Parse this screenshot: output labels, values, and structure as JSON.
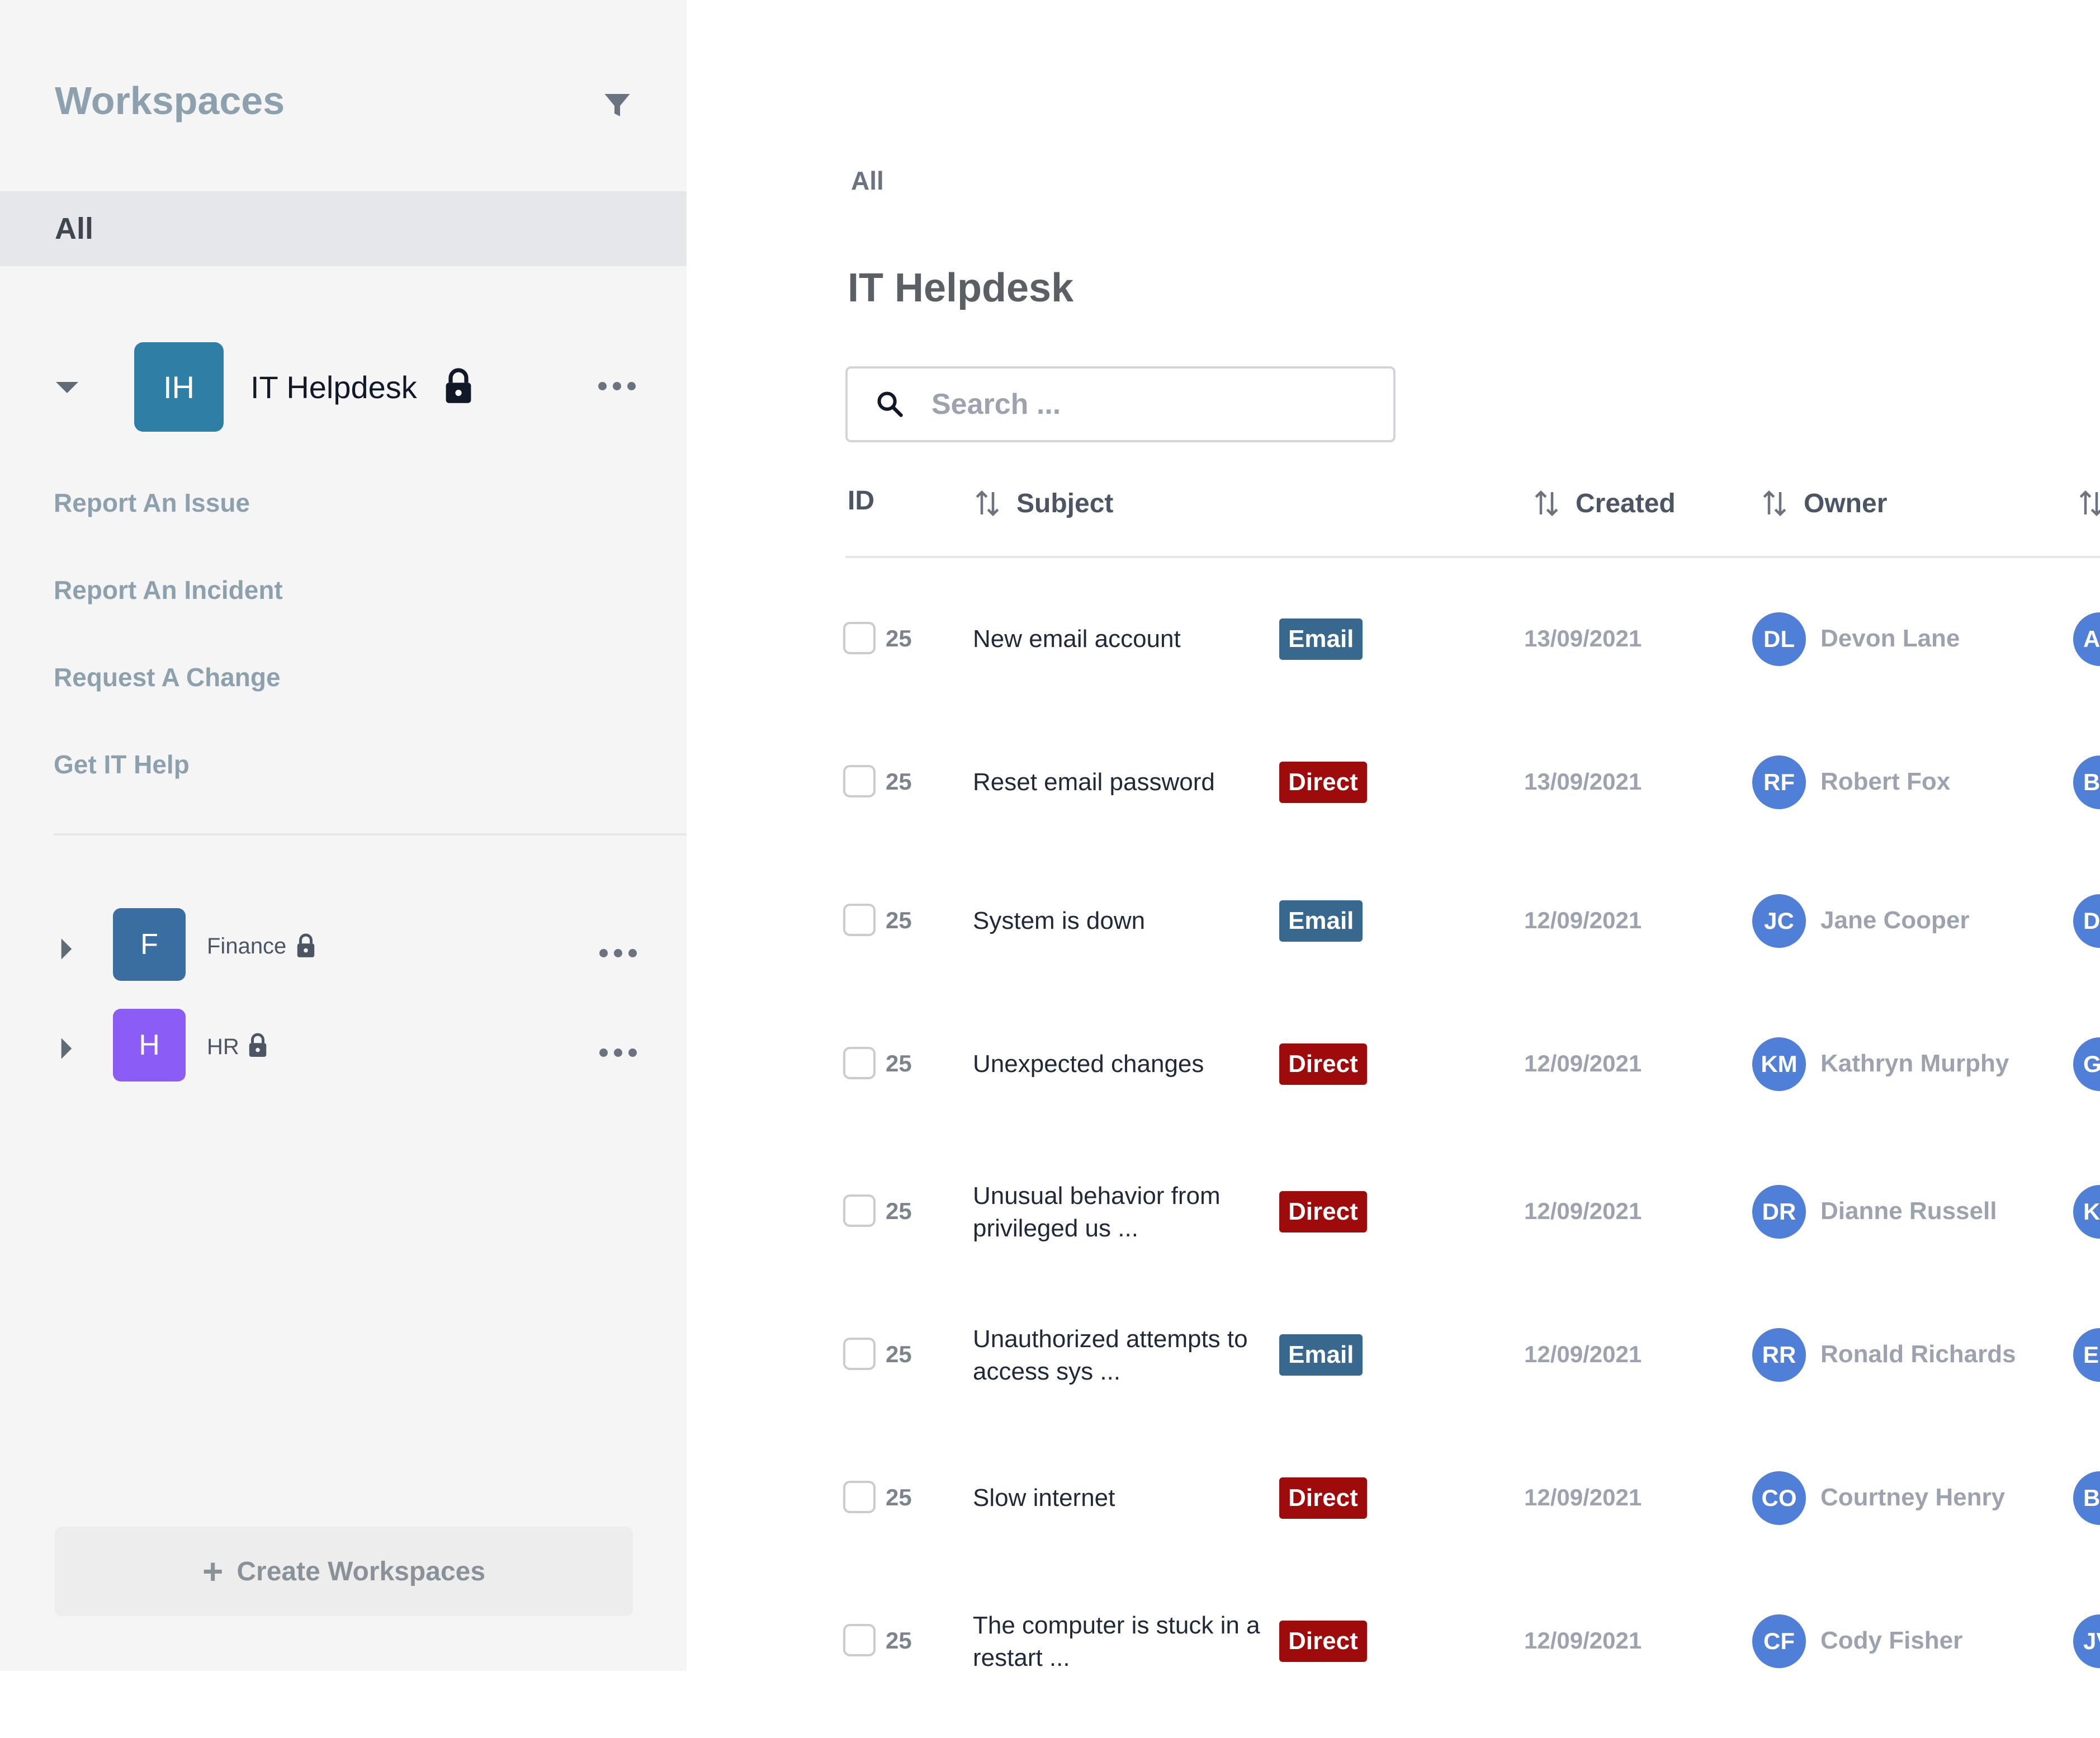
{
  "sidebar": {
    "title": "Workspaces",
    "all_label": "All",
    "active_workspace": {
      "initials": "IH",
      "name": "IT Helpdesk",
      "tile_color": "#2e7ea6",
      "links": [
        "Report An Issue",
        "Report An Incident",
        "Request A Change",
        "Get IT Help"
      ]
    },
    "other_workspaces": [
      {
        "initials": "F",
        "name": "Finance",
        "tile_color": "#3b6ea0"
      },
      {
        "initials": "H",
        "name": "HR",
        "tile_color": "#8b5cf6"
      }
    ],
    "create_label": "Create Workspaces"
  },
  "main": {
    "breadcrumb": "All",
    "title": "IT Helpdesk",
    "search_placeholder": "Search ...",
    "columns": {
      "id": "ID",
      "subject": "Subject",
      "created": "Created",
      "owner": "Owner"
    },
    "rows": [
      {
        "id": "25",
        "subject": [
          "New email account"
        ],
        "tag": "Email",
        "created": "13/09/2021",
        "owner_initials": "DL",
        "owner": "Devon Lane",
        "extra_initials": "A"
      },
      {
        "id": "25",
        "subject": [
          "Reset email password"
        ],
        "tag": "Direct",
        "created": "13/09/2021",
        "owner_initials": "RF",
        "owner": "Robert Fox",
        "extra_initials": "B"
      },
      {
        "id": "25",
        "subject": [
          "System is down"
        ],
        "tag": "Email",
        "created": "12/09/2021",
        "owner_initials": "JC",
        "owner": "Jane Cooper",
        "extra_initials": "D"
      },
      {
        "id": "25",
        "subject": [
          "Unexpected changes"
        ],
        "tag": "Direct",
        "created": "12/09/2021",
        "owner_initials": "KM",
        "owner": "Kathryn Murphy",
        "extra_initials": "G"
      },
      {
        "id": "25",
        "subject": [
          "Unusual behavior from",
          "privileged us ..."
        ],
        "tag": "Direct",
        "created": "12/09/2021",
        "owner_initials": "DR",
        "owner": "Dianne Russell",
        "extra_initials": "K"
      },
      {
        "id": "25",
        "subject": [
          "Unauthorized attempts to",
          "access sys ..."
        ],
        "tag": "Email",
        "created": "12/09/2021",
        "owner_initials": "RR",
        "owner": "Ronald Richards",
        "extra_initials": "E"
      },
      {
        "id": "25",
        "subject": [
          "Slow internet"
        ],
        "tag": "Direct",
        "created": "12/09/2021",
        "owner_initials": "CO",
        "owner": "Courtney Henry",
        "extra_initials": "B"
      },
      {
        "id": "25",
        "subject": [
          "The computer is stuck in a",
          "restart  ..."
        ],
        "tag": "Direct",
        "created": "12/09/2021",
        "owner_initials": "CF",
        "owner": "Cody Fisher",
        "extra_initials": "JV"
      }
    ]
  },
  "colors": {
    "email_tag": "#39688f",
    "direct_tag": "#9e0b0b",
    "avatar": "#4f7fd6",
    "sidebar_bg": "#f5f5f5"
  },
  "icons": {
    "filter": "filter-icon",
    "lock": "lock-icon",
    "search": "search-icon",
    "sort": "sort-icon",
    "more": "more-icon",
    "plus": "plus-icon"
  }
}
